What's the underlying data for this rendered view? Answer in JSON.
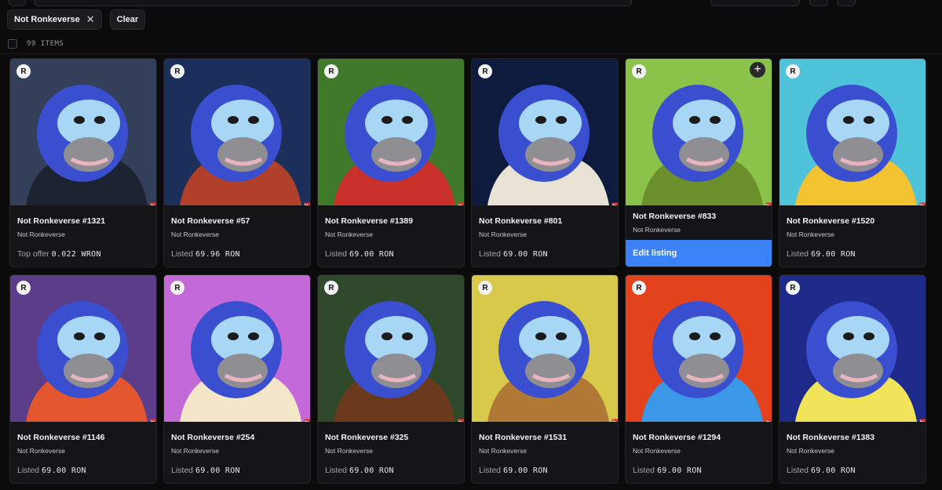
{
  "filters": {
    "active_chip": "Not Ronkeverse",
    "clear_label": "Clear"
  },
  "count_label": "99 ITEMS",
  "cards": [
    {
      "name": "Not Ronkeverse #1321",
      "collection": "Not Ronkeverse",
      "price_label": "Top offer",
      "price_value": "0.022 WRON",
      "bg": "#34405a",
      "outfit": "#1b2230"
    },
    {
      "name": "Not Ronkeverse #57",
      "collection": "Not Ronkeverse",
      "price_label": "Listed",
      "price_value": "69.96 RON",
      "bg": "#1c2f5a",
      "outfit": "#b0402a"
    },
    {
      "name": "Not Ronkeverse #1389",
      "collection": "Not Ronkeverse",
      "price_label": "Listed",
      "price_value": "69.00 RON",
      "bg": "#3f7a2a",
      "outfit": "#c8302a"
    },
    {
      "name": "Not Ronkeverse #801",
      "collection": "Not Ronkeverse",
      "price_label": "Listed",
      "price_value": "69.00 RON",
      "bg": "#0e1b3d",
      "outfit": "#e9e3d6"
    },
    {
      "name": "Not Ronkeverse #833",
      "collection": "Not Ronkeverse",
      "edit_label": "Edit listing",
      "bg": "#8bc34a",
      "outfit": "#6b8f2a"
    },
    {
      "name": "Not Ronkeverse #1520",
      "collection": "Not Ronkeverse",
      "price_label": "Listed",
      "price_value": "69.00 RON",
      "bg": "#4fc3d9",
      "outfit": "#f2c230"
    },
    {
      "name": "Not Ronkeverse #1146",
      "collection": "Not Ronkeverse",
      "price_label": "Listed",
      "price_value": "69.00 RON",
      "bg": "#5b3d8a",
      "outfit": "#e4572e"
    },
    {
      "name": "Not Ronkeverse #254",
      "collection": "Not Ronkeverse",
      "price_label": "Listed",
      "price_value": "69.00 RON",
      "bg": "#c46ad8",
      "outfit": "#f4e6c8"
    },
    {
      "name": "Not Ronkeverse #325",
      "collection": "Not Ronkeverse",
      "price_label": "Listed",
      "price_value": "69.00 RON",
      "bg": "#2e4a2a",
      "outfit": "#6b3a1c"
    },
    {
      "name": "Not Ronkeverse #1531",
      "collection": "Not Ronkeverse",
      "price_label": "Listed",
      "price_value": "69.00 RON",
      "bg": "#d9c94a",
      "outfit": "#b07a36"
    },
    {
      "name": "Not Ronkeverse #1294",
      "collection": "Not Ronkeverse",
      "price_label": "Listed",
      "price_value": "69.00 RON",
      "bg": "#e2421c",
      "outfit": "#3a98e6"
    },
    {
      "name": "Not Ronkeverse #1383",
      "collection": "Not Ronkeverse",
      "price_label": "Listed",
      "price_value": "69.00 RON",
      "bg": "#1d2a8a",
      "outfit": "#f1e35a"
    }
  ],
  "icons": {
    "badge": "ronin-logo-icon",
    "fan_art": "FAN ART",
    "add": "plus-icon"
  }
}
